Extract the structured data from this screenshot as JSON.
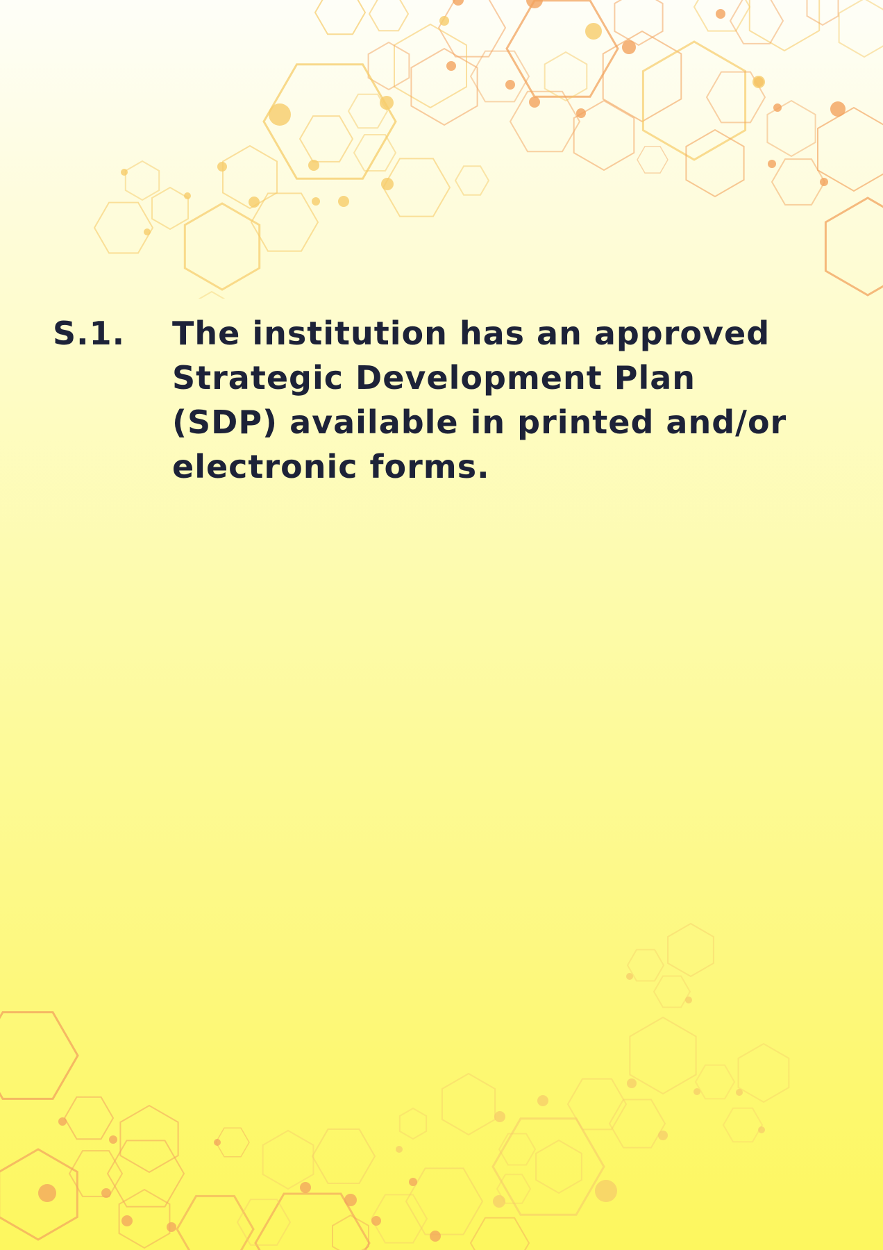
{
  "criterion": {
    "number": "S.1.",
    "text": "The institution has an approved Strategic Development Plan (SDP) available in printed and/or electronic forms."
  },
  "colors": {
    "text": "#1d2238",
    "background_top": "#fefef8",
    "background_bottom": "#fdf75e",
    "hex_orange": "#f2a35e",
    "hex_yellow": "#f6cc6a"
  }
}
